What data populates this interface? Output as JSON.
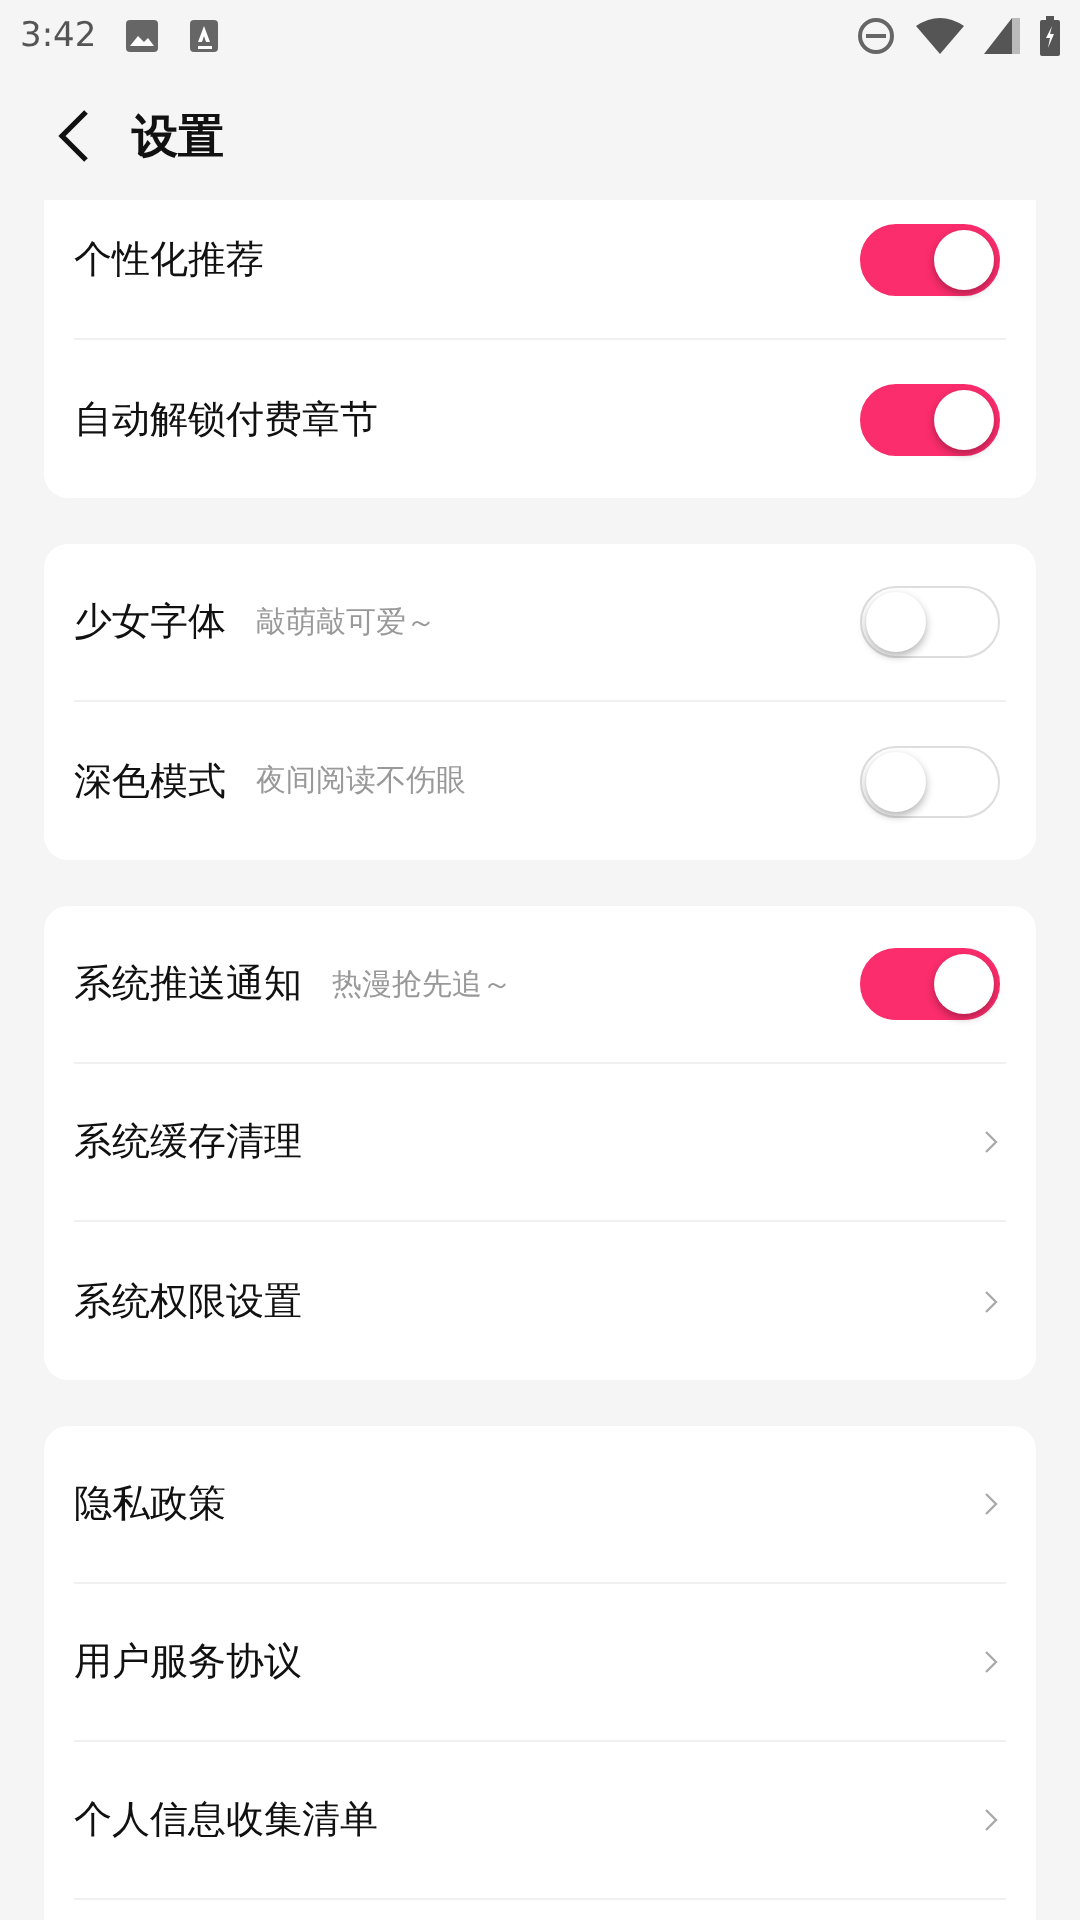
{
  "status_bar": {
    "time": "3:42"
  },
  "header": {
    "title": "设置"
  },
  "sections": [
    {
      "items": [
        {
          "kind": "toggle",
          "label": "个性化推荐",
          "on": true
        },
        {
          "kind": "toggle",
          "label": "自动解锁付费章节",
          "on": true
        }
      ]
    },
    {
      "items": [
        {
          "kind": "toggle",
          "label": "少女字体",
          "hint": "敲萌敲可爱～",
          "on": false
        },
        {
          "kind": "toggle",
          "label": "深色模式",
          "hint": "夜间阅读不伤眼",
          "on": false
        }
      ]
    },
    {
      "items": [
        {
          "kind": "toggle",
          "label": "系统推送通知",
          "hint": "热漫抢先追～",
          "on": true
        },
        {
          "kind": "link",
          "label": "系统缓存清理"
        },
        {
          "kind": "link",
          "label": "系统权限设置"
        }
      ]
    },
    {
      "items": [
        {
          "kind": "link",
          "label": "隐私政策"
        },
        {
          "kind": "link",
          "label": "用户服务协议"
        },
        {
          "kind": "link",
          "label": "个人信息收集清单"
        }
      ]
    }
  ]
}
